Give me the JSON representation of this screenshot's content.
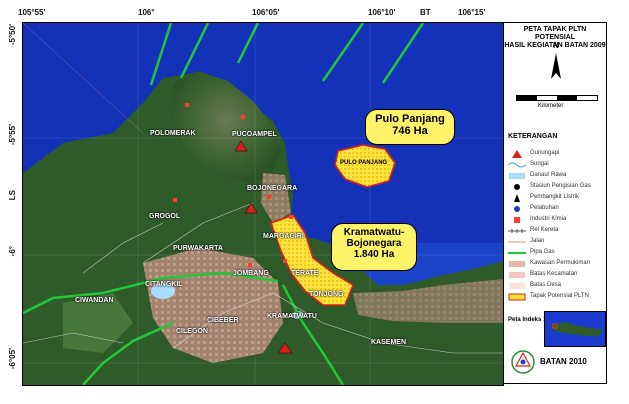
{
  "map": {
    "ticks_top": [
      "105°55'",
      "106°",
      "106°05'",
      "106°10'",
      "106°15'",
      "BT"
    ],
    "ticks_left": [
      "-5°50'",
      "-5°55'",
      "LS",
      "-6°",
      "-6°05'"
    ],
    "places": [
      {
        "name": "Gunung-POLOMERAK",
        "label": "POLOMERAK"
      },
      {
        "name": "pucoampel",
        "label": "PUCOAMPEL"
      },
      {
        "name": "bojonegara",
        "label": "BOJONEGARA"
      },
      {
        "name": "grogol",
        "label": "GROGOL"
      },
      {
        "name": "purwakarta",
        "label": "PURWAKARTA"
      },
      {
        "name": "cilegon-north",
        "label": "CIWANDAN"
      },
      {
        "name": "jombang",
        "label": "JOMBANG"
      },
      {
        "name": "citangkil",
        "label": "CITANGKIL"
      },
      {
        "name": "cilegon",
        "label": "CILEGON"
      },
      {
        "name": "cibeber",
        "label": "CIBEBER"
      },
      {
        "name": "kramatwatu",
        "label": "KRAMATWATU"
      },
      {
        "name": "terate",
        "label": "TERATE"
      },
      {
        "name": "tonjong",
        "label": "TONJONG"
      },
      {
        "name": "margagiri",
        "label": "MARGAGIRI"
      },
      {
        "name": "kasemen",
        "label": "KASEMEN"
      },
      {
        "name": "pulo-panjang-small",
        "label": "PULO PANJANG"
      }
    ],
    "callouts": {
      "pulo_title": "Pulo Panjang",
      "pulo_area": "746 Ha",
      "kramat_title": "Kramatwatu-",
      "kramat_title2": "Bojonegara",
      "kramat_area": "1.840 Ha"
    }
  },
  "legend": {
    "title_line1": "PETA TAPAK PLTN POTENSIAL",
    "title_line2": "HASIL KEGIATAN BATAN 2009",
    "north": "N",
    "scale_label": "Kilometer",
    "scale_ticks": [
      "0",
      "1",
      "2",
      "3",
      "4"
    ],
    "keterangan": "KETERANGAN",
    "items": [
      {
        "label": "Gunungapi",
        "icon": "volcano-icon"
      },
      {
        "label": "Sungai",
        "icon": "river-icon"
      },
      {
        "label": "Danau/ Rawa",
        "icon": "lake-icon"
      },
      {
        "label": "Stasiun Pengisian Gas",
        "icon": "gas-station-icon"
      },
      {
        "label": "Pembangkit Listrik",
        "icon": "power-plant-icon"
      },
      {
        "label": "Pelabuhan",
        "icon": "port-icon"
      },
      {
        "label": "Industri Kimia",
        "icon": "chemical-industry-icon"
      },
      {
        "label": "Rel Kereta",
        "icon": "railway-icon"
      },
      {
        "label": "Jalan",
        "icon": "road-icon"
      },
      {
        "label": "Pipa Gas",
        "icon": "gas-pipe-icon"
      },
      {
        "label": "Kawasan Permukiman",
        "icon": "settlement-icon"
      },
      {
        "label": "Batas Kecamatan",
        "icon": "district-boundary-icon"
      },
      {
        "label": "Batas Desa",
        "icon": "village-boundary-icon"
      },
      {
        "label": "Tapak Potensial PLTN",
        "icon": "potential-site-icon"
      }
    ],
    "index_label": "Peta Indeks :",
    "org": "BATAN 2010"
  },
  "colors": {
    "sea": "#1432b8",
    "land": "#2f5a2a",
    "site": "#ffe23a",
    "callout": "#fff36a",
    "pipe": "#22c73a"
  }
}
